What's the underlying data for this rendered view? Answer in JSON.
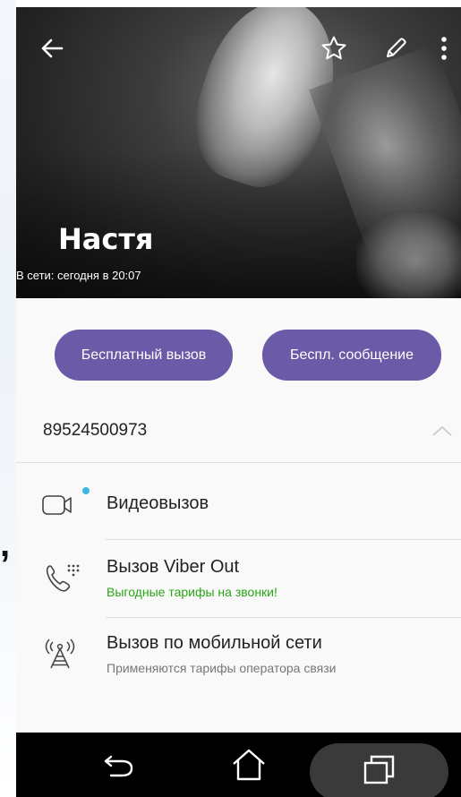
{
  "contact": {
    "name": "Настя",
    "status": "В сети: сегодня в 20:07",
    "phone": "89524500973"
  },
  "actions": {
    "free_call_label": "Бесплатный вызов",
    "free_message_label": "Беспл. сообщение"
  },
  "options": [
    {
      "title": "Видеовызов",
      "subtitle": "",
      "icon": "video-camera-icon"
    },
    {
      "title": "Вызов Viber Out",
      "subtitle": "Выгодные тарифы на звонки!",
      "icon": "phone-keypad-icon"
    },
    {
      "title": "Вызов по мобильной сети",
      "subtitle": "Применяются тарифы оператора связи",
      "icon": "cell-tower-icon"
    }
  ],
  "colors": {
    "accent": "#6a5aa8",
    "promo_green": "#2aa516",
    "online_dot": "#3ab6e6",
    "subtitle_gray": "#777777"
  },
  "toolbar": {
    "back_icon": "back-arrow-icon",
    "favorite_icon": "star-icon",
    "edit_icon": "pencil-icon",
    "more_icon": "more-vert-icon"
  },
  "system_nav": {
    "back_icon": "nav-back-icon",
    "home_icon": "nav-home-icon",
    "recents_icon": "nav-recents-icon"
  }
}
